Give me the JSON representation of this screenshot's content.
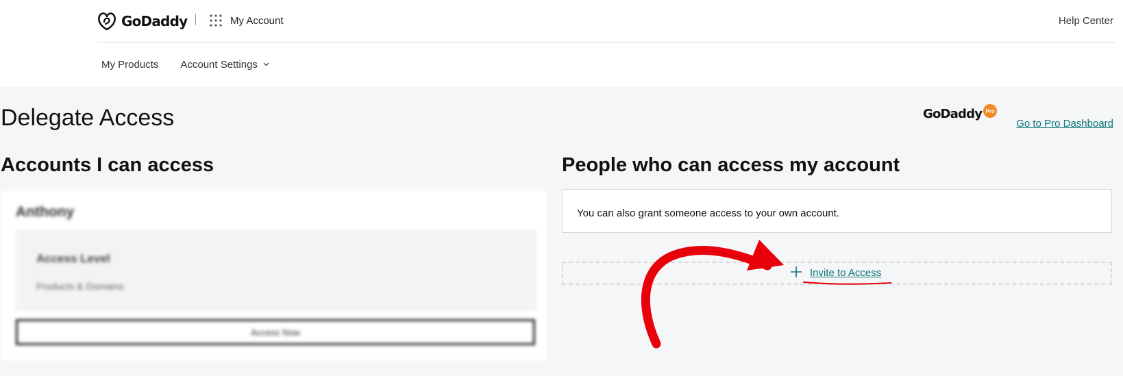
{
  "header": {
    "brand": "GoDaddy",
    "app_title": "My Account",
    "help_link": "Help Center",
    "nav": [
      "My Products",
      "Account Settings"
    ]
  },
  "main": {
    "page_title": "Delegate Access",
    "pro": {
      "logo_text": "GoDaddy",
      "badge": "Pro",
      "link": "Go to Pro Dashboard"
    },
    "left_section": {
      "heading": "Accounts I can access",
      "card": {
        "account_name": "Anthony",
        "level_label": "Access Level",
        "level_value": "Products & Domains",
        "button": "Access Now"
      }
    },
    "right_section": {
      "heading": "People who can access my account",
      "info": "You can also grant someone access to your own account.",
      "invite": "Invite to Access"
    }
  },
  "colors": {
    "link": "#09757a",
    "annotation_arrow": "#e8000a",
    "pro_badge": "#f08a24"
  },
  "icons": [
    "godaddy-logo-icon",
    "apps-grid-icon",
    "chevron-down-icon",
    "plus-icon",
    "red-arrow-annotation"
  ]
}
